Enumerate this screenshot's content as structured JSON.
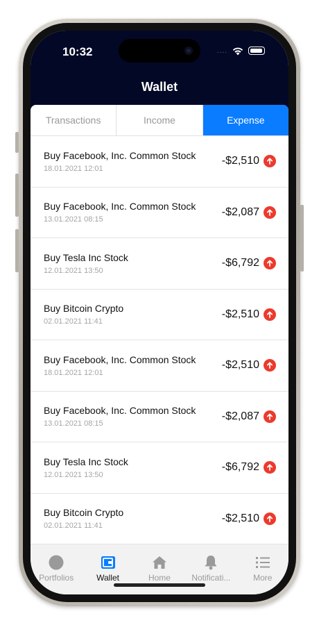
{
  "status": {
    "time": "10:32",
    "signal": "...."
  },
  "header": {
    "title": "Wallet"
  },
  "segments": [
    {
      "label": "Transactions",
      "active": false
    },
    {
      "label": "Income",
      "active": false
    },
    {
      "label": "Expense",
      "active": true
    }
  ],
  "transactions": [
    {
      "title": "Buy Facebook, Inc. Common Stock",
      "date": "18.01.2021  12:01",
      "amount": "-$2,510",
      "direction": "up"
    },
    {
      "title": "Buy Facebook, Inc. Common Stock",
      "date": "13.01.2021  08:15",
      "amount": "-$2,087",
      "direction": "up"
    },
    {
      "title": "Buy Tesla Inc Stock",
      "date": "12.01.2021  13:50",
      "amount": "-$6,792",
      "direction": "up"
    },
    {
      "title": "Buy Bitcoin Crypto",
      "date": "02.01.2021  11:41",
      "amount": "-$2,510",
      "direction": "up"
    },
    {
      "title": "Buy Facebook, Inc. Common Stock",
      "date": "18.01.2021  12:01",
      "amount": "-$2,510",
      "direction": "up"
    },
    {
      "title": "Buy Facebook, Inc. Common Stock",
      "date": "13.01.2021  08:15",
      "amount": "-$2,087",
      "direction": "up"
    },
    {
      "title": "Buy Tesla Inc Stock",
      "date": "12.01.2021  13:50",
      "amount": "-$6,792",
      "direction": "up"
    },
    {
      "title": "Buy Bitcoin Crypto",
      "date": "02.01.2021  11:41",
      "amount": "-$2,510",
      "direction": "up"
    }
  ],
  "tabs": [
    {
      "label": "Portfolios",
      "icon": "portfolio-circle-icon",
      "active": false
    },
    {
      "label": "Wallet",
      "icon": "wallet-icon",
      "active": true
    },
    {
      "label": "Home",
      "icon": "home-icon",
      "active": false
    },
    {
      "label": "Notificati...",
      "icon": "bell-icon",
      "active": false
    },
    {
      "label": "More",
      "icon": "list-icon",
      "active": false
    }
  ],
  "colors": {
    "header_bg": "#030826",
    "accent": "#0a7cff",
    "expense_arrow": "#ec3a2d"
  }
}
